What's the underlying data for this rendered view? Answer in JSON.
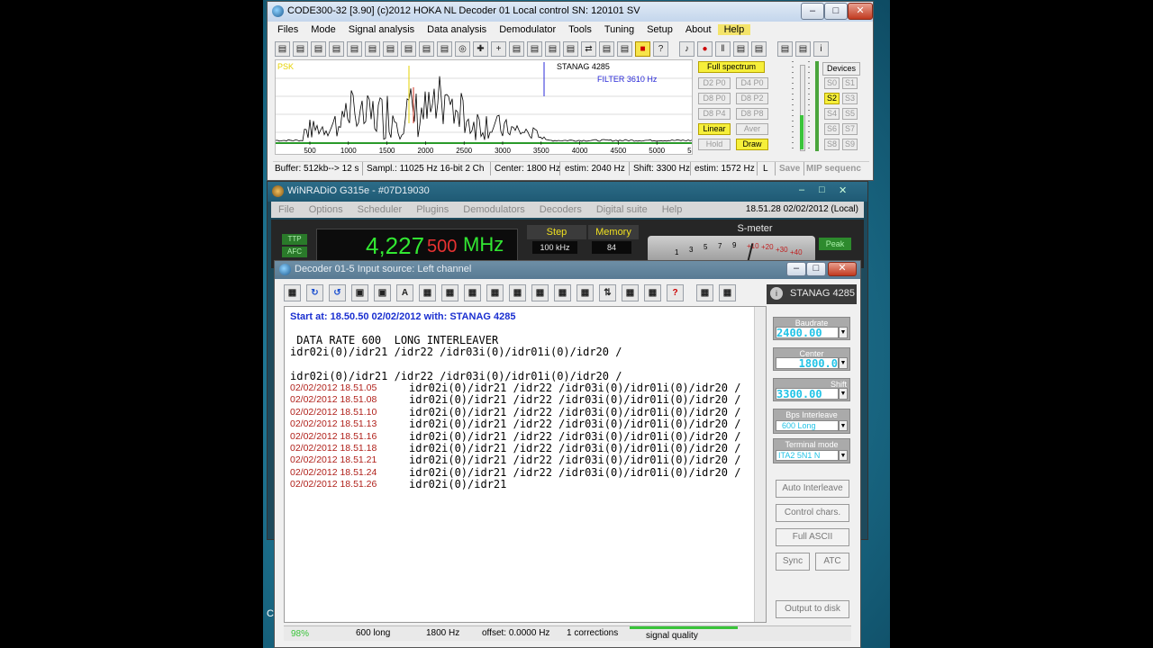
{
  "code300": {
    "title": "CODE300-32 [3.90] (c)2012 HOKA NL     Decoder 01          Local control      SN: 120101 SV",
    "menu": [
      "Files",
      "Mode",
      "Signal analysis",
      "Data analysis",
      "Demodulator",
      "Tools",
      "Tuning",
      "Setup",
      "About",
      "Help"
    ],
    "spectrum_tag": "PSK",
    "spectrum_mode": "STANAG 4285",
    "filter_label": "FILTER 3610 Hz",
    "axis_ticks": [
      "500",
      "1000",
      "1500",
      "2000",
      "2500",
      "3000",
      "3500",
      "4000",
      "4500",
      "5000",
      "5500"
    ],
    "buttons": {
      "full_spectrum": "Full spectrum",
      "grid": [
        "D2 P0",
        "D4 P0",
        "D8 P0",
        "D8 P2",
        "D8 P4",
        "D8 P8"
      ],
      "linear": "Linear",
      "aver": "Aver",
      "hold": "Hold",
      "draw": "Draw"
    },
    "devices_label": "Devices",
    "devices": [
      "S0",
      "S1",
      "S2",
      "S3",
      "S4",
      "S5",
      "S6",
      "S7",
      "S8",
      "S9"
    ],
    "status": {
      "buffer": "Buffer: 512kb--> 12 s",
      "sampl": "Sampl.: 11025 Hz 16-bit 2 Ch",
      "center": "Center: 1800 Hz",
      "estim1": "estim: 2040 Hz",
      "shift": "Shift: 3300 Hz",
      "estim2": "estim: 1572 Hz",
      "l": "L",
      "save": "Save",
      "mip": "MIP sequenc"
    }
  },
  "winradio": {
    "title": "WiNRADiO G315e - #07D19030",
    "menu": [
      "File",
      "Options",
      "Scheduler",
      "Plugins",
      "Demodulators",
      "Decoders",
      "Digital suite",
      "Help"
    ],
    "datetime": "18.51.28  02/02/2012 (Local)",
    "ttp": "TTP",
    "afc": "AFC",
    "freq_main": "4,227",
    "freq_fine": "500",
    "freq_unit": "MHz",
    "step_label": "Step",
    "step_value": "100 kHz",
    "memory_label": "Memory",
    "memory_value": "84",
    "smeter_label": "S-meter",
    "smeter_scale": [
      "1",
      "3",
      "5",
      "7",
      "9",
      "+10",
      "+20",
      "+30",
      "+40"
    ],
    "peak": "Peak"
  },
  "decoder": {
    "title": "Decoder 01-5         Input source: Left channel",
    "mode_name": "STANAG 4285",
    "start_line": "Start at: 18.50.50  02/02/2012  with:  STANAG 4285",
    "header1": " DATA RATE 600  LONG INTERLEAVER",
    "header2": "idr02i(0)/idr21 /idr22 /idr03i(0)/idr01i(0)/idr20 /",
    "header3": "idr02i(0)/idr21 /idr22 /idr03i(0)/idr01i(0)/idr20 /",
    "rows": [
      {
        "ts": "02/02/2012 18.51.05",
        "txt": "idr02i(0)/idr21 /idr22 /idr03i(0)/idr01i(0)/idr20 /"
      },
      {
        "ts": "02/02/2012 18.51.08",
        "txt": "idr02i(0)/idr21 /idr22 /idr03i(0)/idr01i(0)/idr20 /"
      },
      {
        "ts": "02/02/2012 18.51.10",
        "txt": "idr02i(0)/idr21 /idr22 /idr03i(0)/idr01i(0)/idr20 /"
      },
      {
        "ts": "02/02/2012 18.51.13",
        "txt": "idr02i(0)/idr21 /idr22 /idr03i(0)/idr01i(0)/idr20 /"
      },
      {
        "ts": "02/02/2012 18.51.16",
        "txt": "idr02i(0)/idr21 /idr22 /idr03i(0)/idr01i(0)/idr20 /"
      },
      {
        "ts": "02/02/2012 18.51.18",
        "txt": "idr02i(0)/idr21 /idr22 /idr03i(0)/idr01i(0)/idr20 /"
      },
      {
        "ts": "02/02/2012 18.51.21",
        "txt": "idr02i(0)/idr21 /idr22 /idr03i(0)/idr01i(0)/idr20 /"
      },
      {
        "ts": "02/02/2012 18.51.24",
        "txt": "idr02i(0)/idr21 /idr22 /idr03i(0)/idr01i(0)/idr20 /"
      },
      {
        "ts": "02/02/2012 18.51.26",
        "txt": "idr02i(0)/idr21"
      }
    ],
    "baudrate_label": "Baudrate",
    "baudrate_value": "2400.00",
    "center_label": "Center",
    "center_value": "1800.0",
    "shift_label": "Shift",
    "shift_value": "3300.00",
    "bps_label": "Bps Interleave",
    "bps_value": "600  Long",
    "terminal_label": "Terminal mode",
    "terminal_value": "ITA2  5N1  N",
    "auto_interleave": "Auto Interleave",
    "control_chars": "Control chars.",
    "full_ascii": "Full ASCII",
    "sync": "Sync",
    "atc": "ATC",
    "output_to_disk": "Output to disk",
    "status": {
      "pct": "98%",
      "mode": "600 long",
      "freq": "1800 Hz",
      "offset": "offset: 0.0000 Hz",
      "corrections": "1 corrections",
      "quality": "signal quality"
    }
  },
  "desktop_fragment": "C",
  "colors": {
    "ts_red": "#b0201a",
    "lcd_cyan": "#22c3e6",
    "start_blue": "#1a2fd0",
    "freq_green": "#32e832"
  }
}
